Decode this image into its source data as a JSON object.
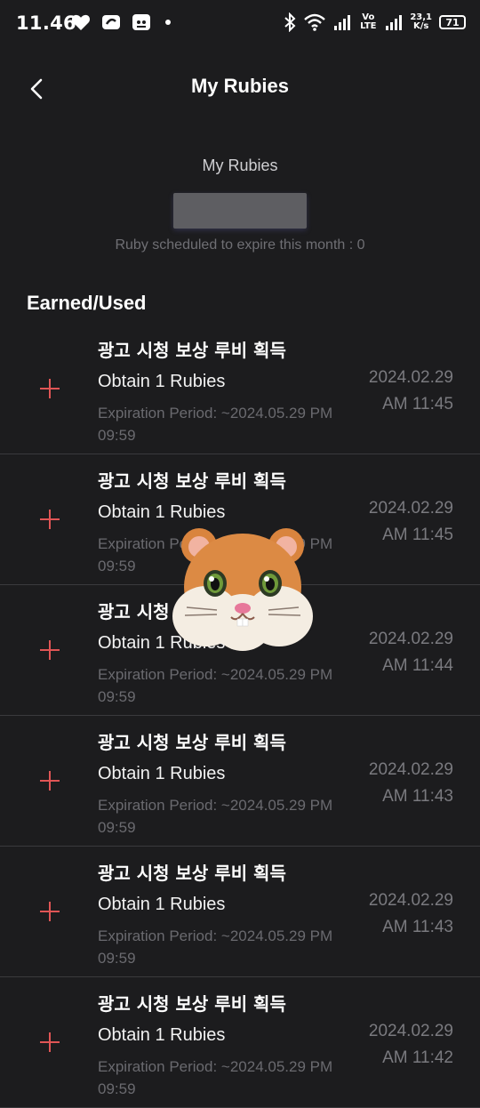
{
  "status_bar": {
    "time": "11.46",
    "network_type": "Vo LTE",
    "speed_value": "23,1",
    "speed_unit": "K/s",
    "battery": "71"
  },
  "header": {
    "title": "My Rubies"
  },
  "balance": {
    "label": "My Rubies",
    "expire_note": "Ruby scheduled to expire this month : 0"
  },
  "section": {
    "title": "Earned/Used"
  },
  "history": [
    {
      "title": "광고 시청 보상 루비 획득",
      "subtitle": "Obtain 1 Rubies",
      "expiry": "Expiration Period: ~2024.05.29 PM 09:59",
      "date": "2024.02.29",
      "time": "AM 11:45"
    },
    {
      "title": "광고 시청 보상 루비 획득",
      "subtitle": "Obtain 1 Rubies",
      "expiry": "Expiration Period: ~2024.05.29 PM 09:59",
      "date": "2024.02.29",
      "time": "AM 11:45"
    },
    {
      "title": "광고 시청 보상 루비 획득",
      "subtitle": "Obtain 1 Rubies",
      "expiry": "Expiration Period: ~2024.05.29 PM 09:59",
      "date": "2024.02.29",
      "time": "AM 11:44"
    },
    {
      "title": "광고 시청 보상 루비 획득",
      "subtitle": "Obtain 1 Rubies",
      "expiry": "Expiration Period: ~2024.05.29 PM 09:59",
      "date": "2024.02.29",
      "time": "AM 11:43"
    },
    {
      "title": "광고 시청 보상 루비 획득",
      "subtitle": "Obtain 1 Rubies",
      "expiry": "Expiration Period: ~2024.05.29 PM 09:59",
      "date": "2024.02.29",
      "time": "AM 11:43"
    },
    {
      "title": "광고 시청 보상 루비 획득",
      "subtitle": "Obtain 1 Rubies",
      "expiry": "Expiration Period: ~2024.05.29 PM 09:59",
      "date": "2024.02.29",
      "time": "AM 11:42"
    }
  ],
  "colors": {
    "background": "#1c1c1e",
    "plus_accent": "#e05555",
    "divider": "#3a3a3d"
  },
  "icons": {
    "back": "chevron-left-icon",
    "earned": "plus-icon",
    "overlay": "hamster-emoji-icon"
  }
}
